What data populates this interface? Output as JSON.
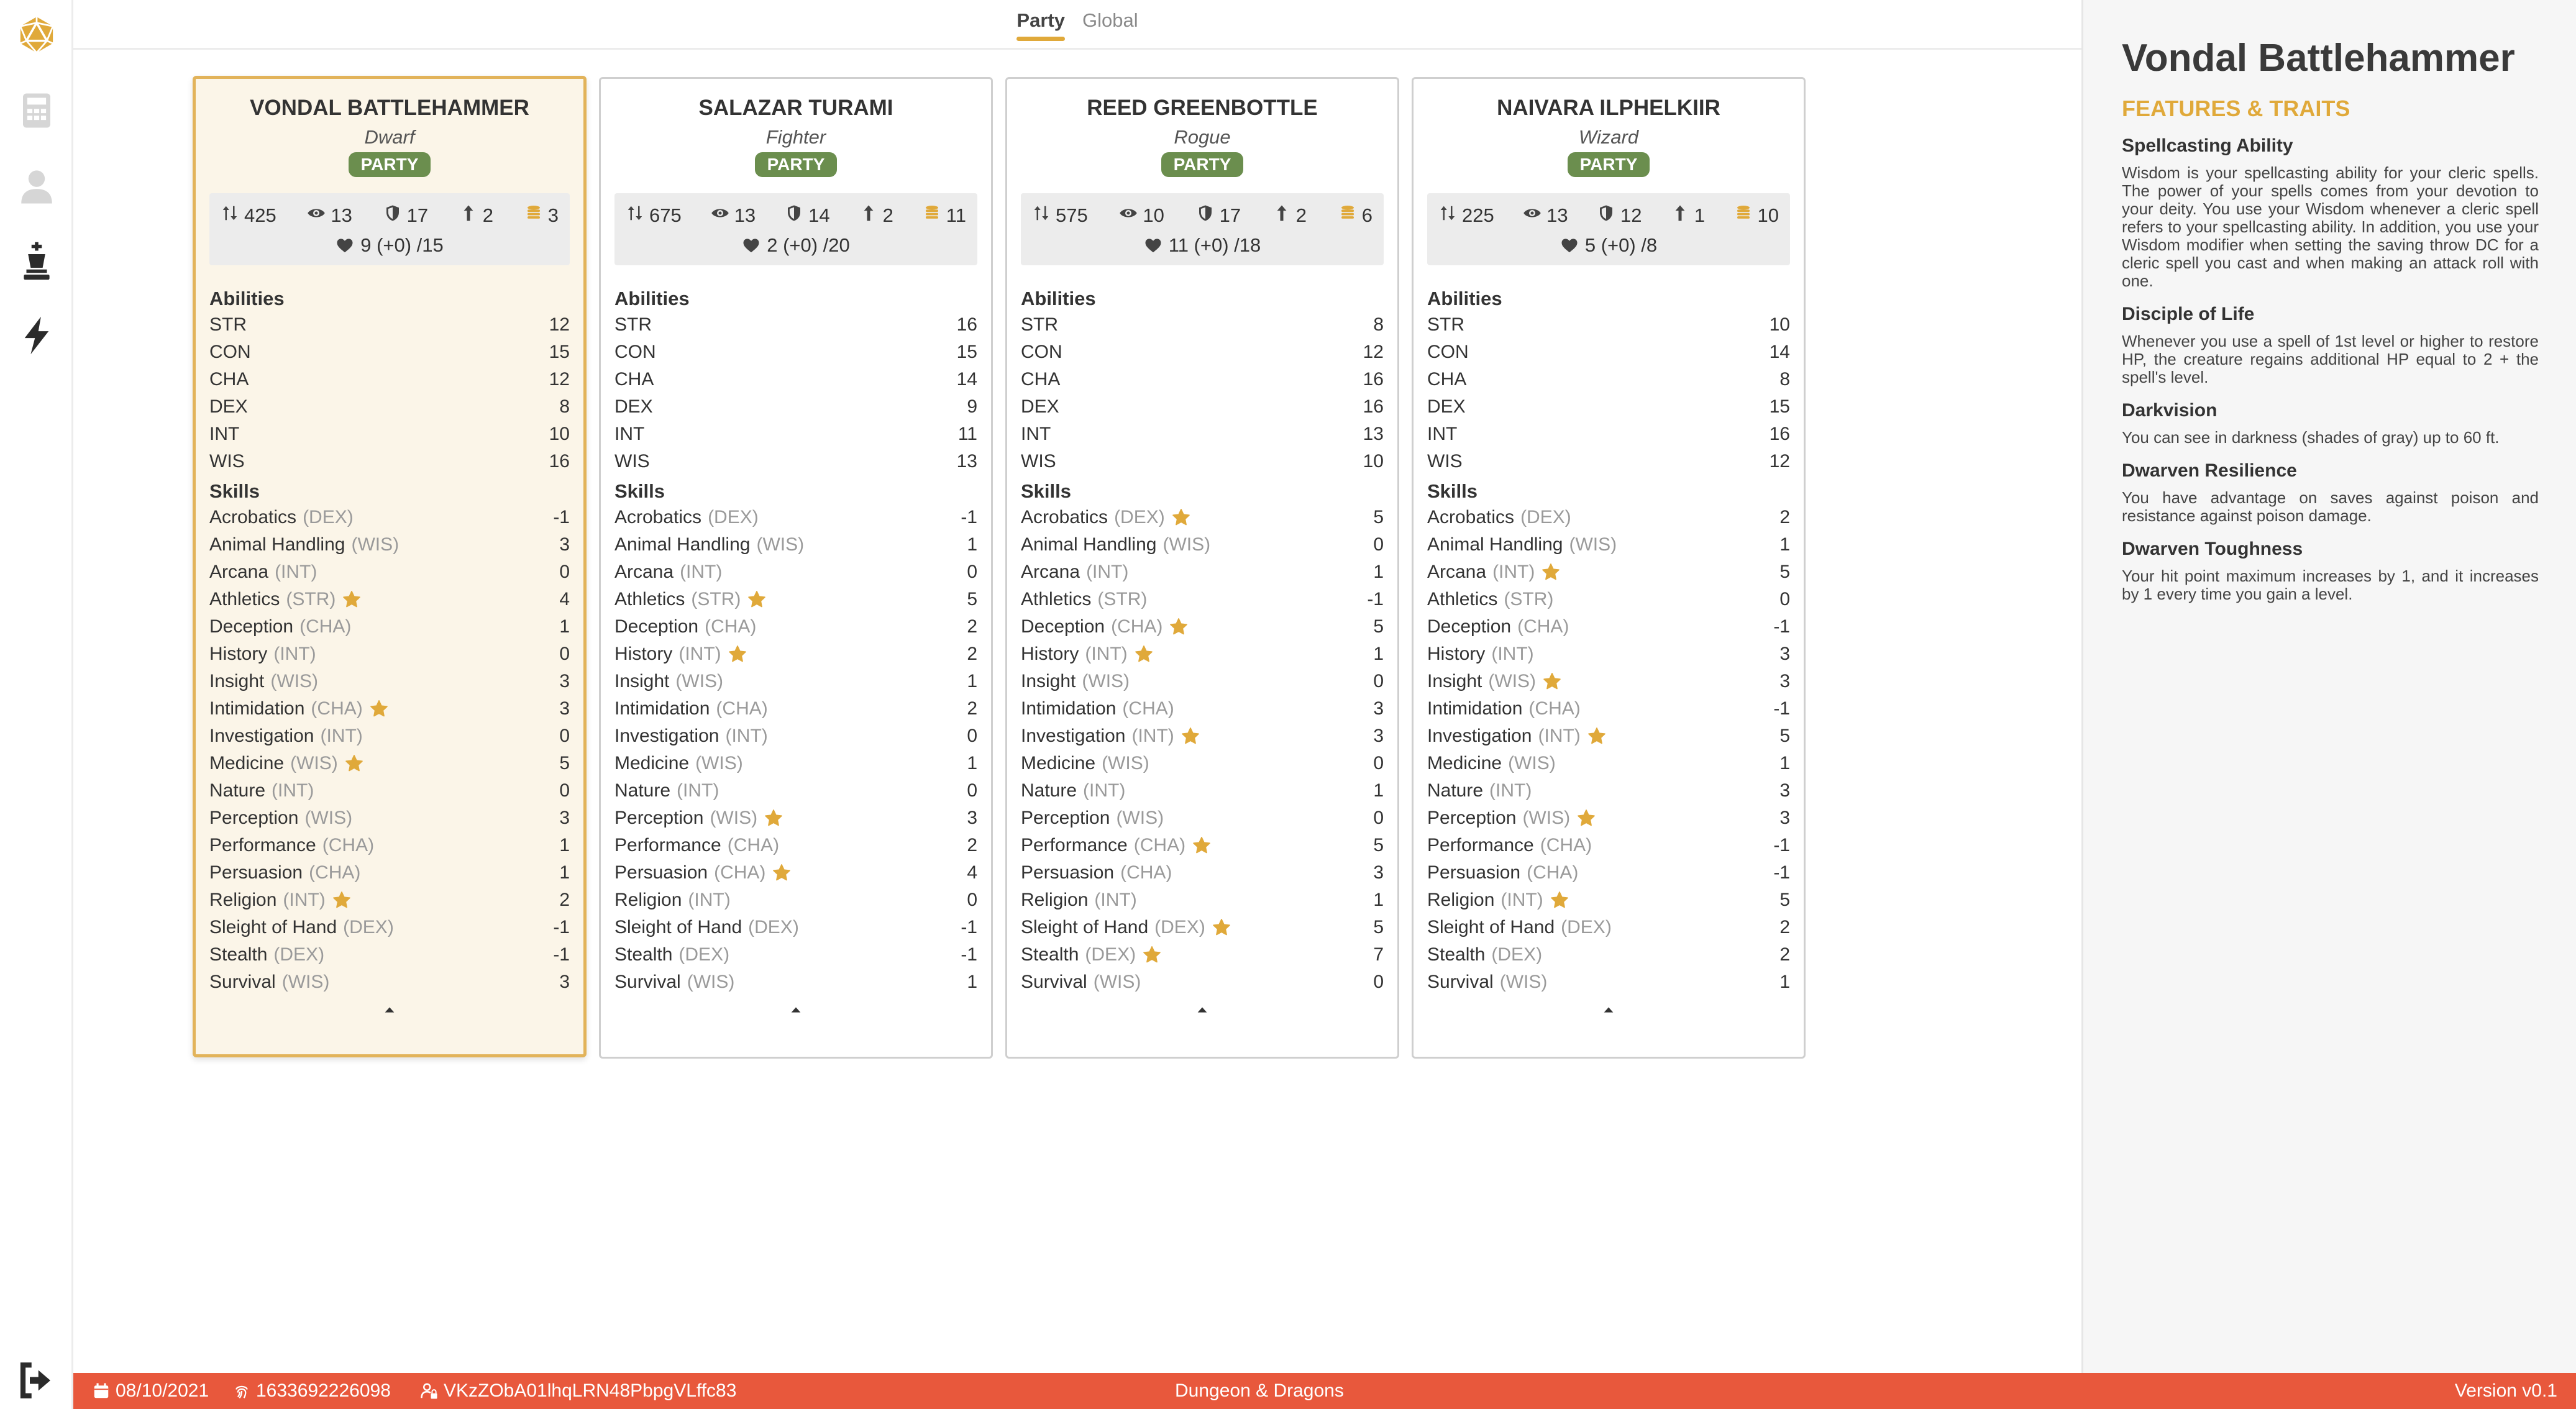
{
  "tabs": [
    {
      "label": "Party",
      "active": true
    },
    {
      "label": "Global",
      "active": false
    }
  ],
  "sidebar": {
    "icons": [
      "d20-icon",
      "calculator-icon",
      "user-icon",
      "chess-king-icon",
      "lightning-icon"
    ],
    "bottom_icon": "logout-icon"
  },
  "cards": [
    {
      "name": "VONDAL BATTLEHAMMER",
      "race": "Dwarf",
      "badge": "PARTY",
      "selected": true,
      "stats": {
        "initiative": "425",
        "perception": "13",
        "ac": "17",
        "level": "2",
        "gold": "3",
        "hp": "9 (+0) /15"
      },
      "abilities_title": "Abilities",
      "abilities": [
        {
          "name": "STR",
          "value": "12"
        },
        {
          "name": "CON",
          "value": "15"
        },
        {
          "name": "CHA",
          "value": "12"
        },
        {
          "name": "DEX",
          "value": "8"
        },
        {
          "name": "INT",
          "value": "10"
        },
        {
          "name": "WIS",
          "value": "16"
        }
      ],
      "skills_title": "Skills",
      "skills": [
        {
          "name": "Acrobatics",
          "attr": "(DEX)",
          "star": false,
          "value": "-1"
        },
        {
          "name": "Animal Handling",
          "attr": "(WIS)",
          "star": false,
          "value": "3"
        },
        {
          "name": "Arcana",
          "attr": "(INT)",
          "star": false,
          "value": "0"
        },
        {
          "name": "Athletics",
          "attr": "(STR)",
          "star": true,
          "value": "4"
        },
        {
          "name": "Deception",
          "attr": "(CHA)",
          "star": false,
          "value": "1"
        },
        {
          "name": "History",
          "attr": "(INT)",
          "star": false,
          "value": "0"
        },
        {
          "name": "Insight",
          "attr": "(WIS)",
          "star": false,
          "value": "3"
        },
        {
          "name": "Intimidation",
          "attr": "(CHA)",
          "star": true,
          "value": "3"
        },
        {
          "name": "Investigation",
          "attr": "(INT)",
          "star": false,
          "value": "0"
        },
        {
          "name": "Medicine",
          "attr": "(WIS)",
          "star": true,
          "value": "5"
        },
        {
          "name": "Nature",
          "attr": "(INT)",
          "star": false,
          "value": "0"
        },
        {
          "name": "Perception",
          "attr": "(WIS)",
          "star": false,
          "value": "3"
        },
        {
          "name": "Performance",
          "attr": "(CHA)",
          "star": false,
          "value": "1"
        },
        {
          "name": "Persuasion",
          "attr": "(CHA)",
          "star": false,
          "value": "1"
        },
        {
          "name": "Religion",
          "attr": "(INT)",
          "star": true,
          "value": "2"
        },
        {
          "name": "Sleight of Hand",
          "attr": "(DEX)",
          "star": false,
          "value": "-1"
        },
        {
          "name": "Stealth",
          "attr": "(DEX)",
          "star": false,
          "value": "-1"
        },
        {
          "name": "Survival",
          "attr": "(WIS)",
          "star": false,
          "value": "3"
        }
      ]
    },
    {
      "name": "SALAZAR TURAMI",
      "race": "Fighter",
      "badge": "PARTY",
      "selected": false,
      "stats": {
        "initiative": "675",
        "perception": "13",
        "ac": "14",
        "level": "2",
        "gold": "11",
        "hp": "2 (+0) /20"
      },
      "abilities_title": "Abilities",
      "abilities": [
        {
          "name": "STR",
          "value": "16"
        },
        {
          "name": "CON",
          "value": "15"
        },
        {
          "name": "CHA",
          "value": "14"
        },
        {
          "name": "DEX",
          "value": "9"
        },
        {
          "name": "INT",
          "value": "11"
        },
        {
          "name": "WIS",
          "value": "13"
        }
      ],
      "skills_title": "Skills",
      "skills": [
        {
          "name": "Acrobatics",
          "attr": "(DEX)",
          "star": false,
          "value": "-1"
        },
        {
          "name": "Animal Handling",
          "attr": "(WIS)",
          "star": false,
          "value": "1"
        },
        {
          "name": "Arcana",
          "attr": "(INT)",
          "star": false,
          "value": "0"
        },
        {
          "name": "Athletics",
          "attr": "(STR)",
          "star": true,
          "value": "5"
        },
        {
          "name": "Deception",
          "attr": "(CHA)",
          "star": false,
          "value": "2"
        },
        {
          "name": "History",
          "attr": "(INT)",
          "star": true,
          "value": "2"
        },
        {
          "name": "Insight",
          "attr": "(WIS)",
          "star": false,
          "value": "1"
        },
        {
          "name": "Intimidation",
          "attr": "(CHA)",
          "star": false,
          "value": "2"
        },
        {
          "name": "Investigation",
          "attr": "(INT)",
          "star": false,
          "value": "0"
        },
        {
          "name": "Medicine",
          "attr": "(WIS)",
          "star": false,
          "value": "1"
        },
        {
          "name": "Nature",
          "attr": "(INT)",
          "star": false,
          "value": "0"
        },
        {
          "name": "Perception",
          "attr": "(WIS)",
          "star": true,
          "value": "3"
        },
        {
          "name": "Performance",
          "attr": "(CHA)",
          "star": false,
          "value": "2"
        },
        {
          "name": "Persuasion",
          "attr": "(CHA)",
          "star": true,
          "value": "4"
        },
        {
          "name": "Religion",
          "attr": "(INT)",
          "star": false,
          "value": "0"
        },
        {
          "name": "Sleight of Hand",
          "attr": "(DEX)",
          "star": false,
          "value": "-1"
        },
        {
          "name": "Stealth",
          "attr": "(DEX)",
          "star": false,
          "value": "-1"
        },
        {
          "name": "Survival",
          "attr": "(WIS)",
          "star": false,
          "value": "1"
        }
      ]
    },
    {
      "name": "REED GREENBOTTLE",
      "race": "Rogue",
      "badge": "PARTY",
      "selected": false,
      "stats": {
        "initiative": "575",
        "perception": "10",
        "ac": "17",
        "level": "2",
        "gold": "6",
        "hp": "11 (+0) /18"
      },
      "abilities_title": "Abilities",
      "abilities": [
        {
          "name": "STR",
          "value": "8"
        },
        {
          "name": "CON",
          "value": "12"
        },
        {
          "name": "CHA",
          "value": "16"
        },
        {
          "name": "DEX",
          "value": "16"
        },
        {
          "name": "INT",
          "value": "13"
        },
        {
          "name": "WIS",
          "value": "10"
        }
      ],
      "skills_title": "Skills",
      "skills": [
        {
          "name": "Acrobatics",
          "attr": "(DEX)",
          "star": true,
          "value": "5"
        },
        {
          "name": "Animal Handling",
          "attr": "(WIS)",
          "star": false,
          "value": "0"
        },
        {
          "name": "Arcana",
          "attr": "(INT)",
          "star": false,
          "value": "1"
        },
        {
          "name": "Athletics",
          "attr": "(STR)",
          "star": false,
          "value": "-1"
        },
        {
          "name": "Deception",
          "attr": "(CHA)",
          "star": true,
          "value": "5"
        },
        {
          "name": "History",
          "attr": "(INT)",
          "star": true,
          "value": "1"
        },
        {
          "name": "Insight",
          "attr": "(WIS)",
          "star": false,
          "value": "0"
        },
        {
          "name": "Intimidation",
          "attr": "(CHA)",
          "star": false,
          "value": "3"
        },
        {
          "name": "Investigation",
          "attr": "(INT)",
          "star": true,
          "value": "3"
        },
        {
          "name": "Medicine",
          "attr": "(WIS)",
          "star": false,
          "value": "0"
        },
        {
          "name": "Nature",
          "attr": "(INT)",
          "star": false,
          "value": "1"
        },
        {
          "name": "Perception",
          "attr": "(WIS)",
          "star": false,
          "value": "0"
        },
        {
          "name": "Performance",
          "attr": "(CHA)",
          "star": true,
          "value": "5"
        },
        {
          "name": "Persuasion",
          "attr": "(CHA)",
          "star": false,
          "value": "3"
        },
        {
          "name": "Religion",
          "attr": "(INT)",
          "star": false,
          "value": "1"
        },
        {
          "name": "Sleight of Hand",
          "attr": "(DEX)",
          "star": true,
          "value": "5"
        },
        {
          "name": "Stealth",
          "attr": "(DEX)",
          "star": true,
          "value": "7"
        },
        {
          "name": "Survival",
          "attr": "(WIS)",
          "star": false,
          "value": "0"
        }
      ]
    },
    {
      "name": "NAIVARA ILPHELKIIR",
      "race": "Wizard",
      "badge": "PARTY",
      "selected": false,
      "stats": {
        "initiative": "225",
        "perception": "13",
        "ac": "12",
        "level": "1",
        "gold": "10",
        "hp": "5 (+0) /8"
      },
      "abilities_title": "Abilities",
      "abilities": [
        {
          "name": "STR",
          "value": "10"
        },
        {
          "name": "CON",
          "value": "14"
        },
        {
          "name": "CHA",
          "value": "8"
        },
        {
          "name": "DEX",
          "value": "15"
        },
        {
          "name": "INT",
          "value": "16"
        },
        {
          "name": "WIS",
          "value": "12"
        }
      ],
      "skills_title": "Skills",
      "skills": [
        {
          "name": "Acrobatics",
          "attr": "(DEX)",
          "star": false,
          "value": "2"
        },
        {
          "name": "Animal Handling",
          "attr": "(WIS)",
          "star": false,
          "value": "1"
        },
        {
          "name": "Arcana",
          "attr": "(INT)",
          "star": true,
          "value": "5"
        },
        {
          "name": "Athletics",
          "attr": "(STR)",
          "star": false,
          "value": "0"
        },
        {
          "name": "Deception",
          "attr": "(CHA)",
          "star": false,
          "value": "-1"
        },
        {
          "name": "History",
          "attr": "(INT)",
          "star": false,
          "value": "3"
        },
        {
          "name": "Insight",
          "attr": "(WIS)",
          "star": true,
          "value": "3"
        },
        {
          "name": "Intimidation",
          "attr": "(CHA)",
          "star": false,
          "value": "-1"
        },
        {
          "name": "Investigation",
          "attr": "(INT)",
          "star": true,
          "value": "5"
        },
        {
          "name": "Medicine",
          "attr": "(WIS)",
          "star": false,
          "value": "1"
        },
        {
          "name": "Nature",
          "attr": "(INT)",
          "star": false,
          "value": "3"
        },
        {
          "name": "Perception",
          "attr": "(WIS)",
          "star": true,
          "value": "3"
        },
        {
          "name": "Performance",
          "attr": "(CHA)",
          "star": false,
          "value": "-1"
        },
        {
          "name": "Persuasion",
          "attr": "(CHA)",
          "star": false,
          "value": "-1"
        },
        {
          "name": "Religion",
          "attr": "(INT)",
          "star": true,
          "value": "5"
        },
        {
          "name": "Sleight of Hand",
          "attr": "(DEX)",
          "star": false,
          "value": "2"
        },
        {
          "name": "Stealth",
          "attr": "(DEX)",
          "star": false,
          "value": "2"
        },
        {
          "name": "Survival",
          "attr": "(WIS)",
          "star": false,
          "value": "1"
        }
      ]
    }
  ],
  "panel": {
    "title": "Vondal Battlehammer",
    "subtitle": "FEATURES & TRAITS",
    "features": [
      {
        "name": "Spellcasting Ability",
        "desc": "Wisdom is your spellcasting ability for your cleric spells. The power of your spells comes from your devotion to your deity. You use your Wisdom whenever a cleric spell refers to your spellcasting ability. In addition, you use your Wisdom modifier when setting the saving throw DC for a cleric spell you cast and when making an attack roll with one."
      },
      {
        "name": "Disciple of Life",
        "desc": "Whenever you use a spell of 1st level or higher to restore HP, the creature regains additional HP equal to 2 + the spell's level."
      },
      {
        "name": "Darkvision",
        "desc": "You can see in darkness (shades of gray) up to 60 ft."
      },
      {
        "name": "Dwarven Resilience",
        "desc": "You have advantage on saves against poison and resistance against poison damage."
      },
      {
        "name": "Dwarven Toughness",
        "desc": "Your hit point maximum increases by 1, and it increases by 1 every time you gain a level."
      }
    ]
  },
  "footer": {
    "date": "08/10/2021",
    "id": "1633692226098",
    "user": "VKzZObA01lhqLRN48PbpgVLffc83",
    "app_name": "Dungeon & Dragons",
    "version": "Version v0.1"
  },
  "colors": {
    "accent": "#e0a93a",
    "party_badge": "#6b8e4e",
    "footer": "#e8583c",
    "selected_card_bg": "#fbf5e8",
    "star": "#e0a93a"
  }
}
